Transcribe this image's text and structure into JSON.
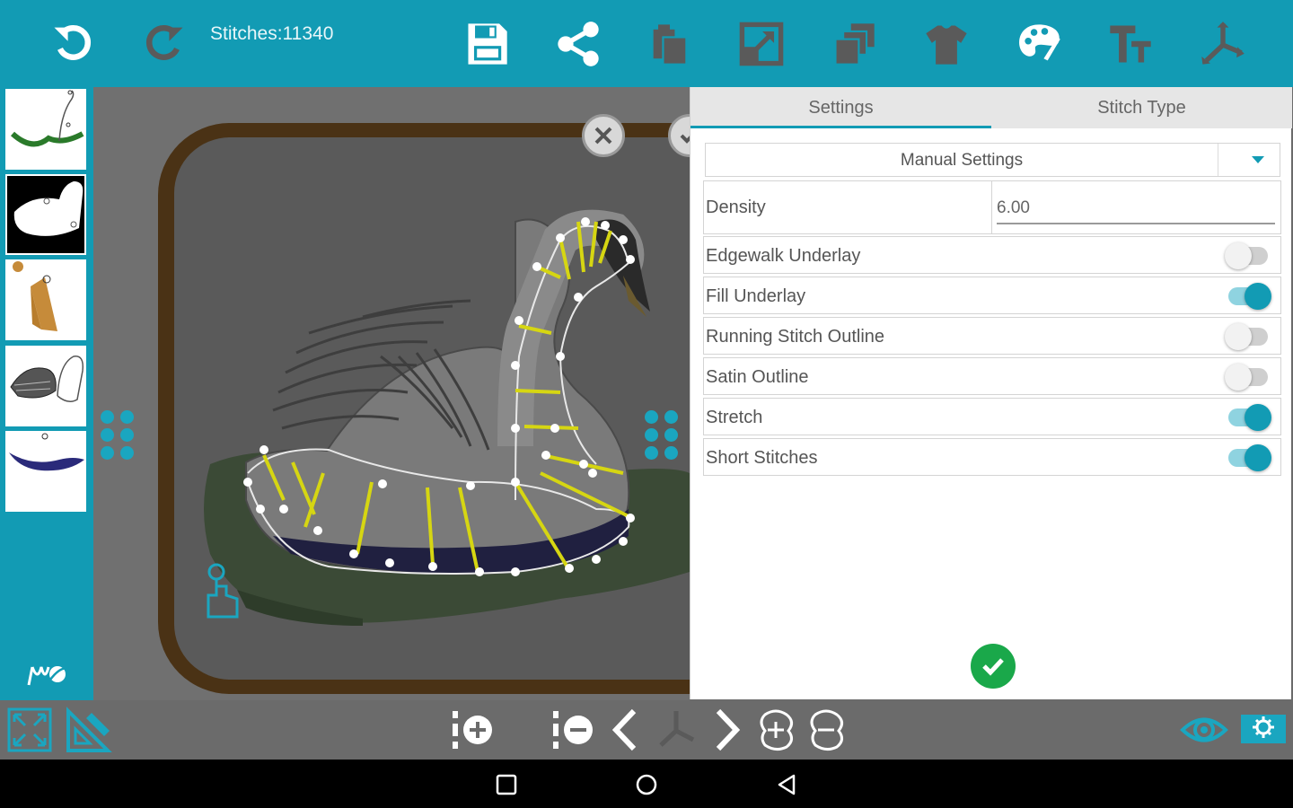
{
  "toolbar": {
    "stitch_count": "Stitches:11340",
    "icons": [
      "undo-icon",
      "redo-icon",
      "save-icon",
      "share-icon",
      "paste-icon",
      "resize-icon",
      "layers-icon",
      "tshirt-icon",
      "palette-icon",
      "text-icon",
      "split-icon"
    ]
  },
  "panel": {
    "tabs": [
      {
        "label": "Settings",
        "active": true
      },
      {
        "label": "Stitch Type",
        "active": false
      }
    ],
    "mode_select": {
      "value": "Manual Settings"
    },
    "density": {
      "label": "Density",
      "value": "6.00"
    },
    "options": [
      {
        "label": "Edgewalk Underlay",
        "on": false
      },
      {
        "label": "Fill Underlay",
        "on": true
      },
      {
        "label": "Running Stitch Outline",
        "on": false
      },
      {
        "label": "Satin Outline",
        "on": false
      },
      {
        "label": "Stretch",
        "on": true
      },
      {
        "label": "Short Stitches",
        "on": true
      }
    ]
  },
  "colors": {
    "accent": "#129bb4",
    "confirm": "#1aa84a",
    "hoop": "#4a3215",
    "canvas": "#707070",
    "guide": "#d6d612"
  },
  "bottom_icons": [
    "fullscreen-icon",
    "ruler-pencil-icon",
    "add-node-icon",
    "remove-node-icon",
    "previous-icon",
    "next-icon",
    "add-point-icon",
    "remove-point-icon",
    "eye-icon",
    "settings-icon"
  ]
}
